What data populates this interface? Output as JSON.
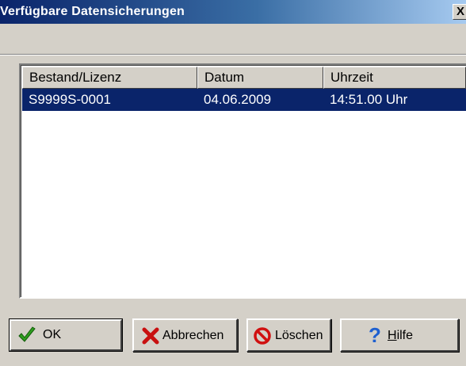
{
  "window": {
    "title": "Verfügbare Datensicherungen",
    "close_label": "X"
  },
  "table": {
    "columns": [
      "Bestand/Lizenz",
      "Datum",
      "Uhrzeit"
    ],
    "rows": [
      {
        "bestand": "S9999S-0001",
        "datum": "04.06.2009",
        "uhrzeit": "14:51.00 Uhr",
        "selected": true
      }
    ]
  },
  "buttons": {
    "ok": {
      "label": "OK",
      "icon": "check-icon"
    },
    "cancel": {
      "label": "Abbrechen",
      "icon": "x-icon"
    },
    "delete": {
      "label": "Löschen",
      "icon": "no-entry-icon"
    },
    "help": {
      "label_first": "H",
      "label_rest": "ilfe",
      "icon": "question-icon"
    }
  },
  "colors": {
    "selection": "#0a246a",
    "dialog_bg": "#d4d0c8"
  }
}
